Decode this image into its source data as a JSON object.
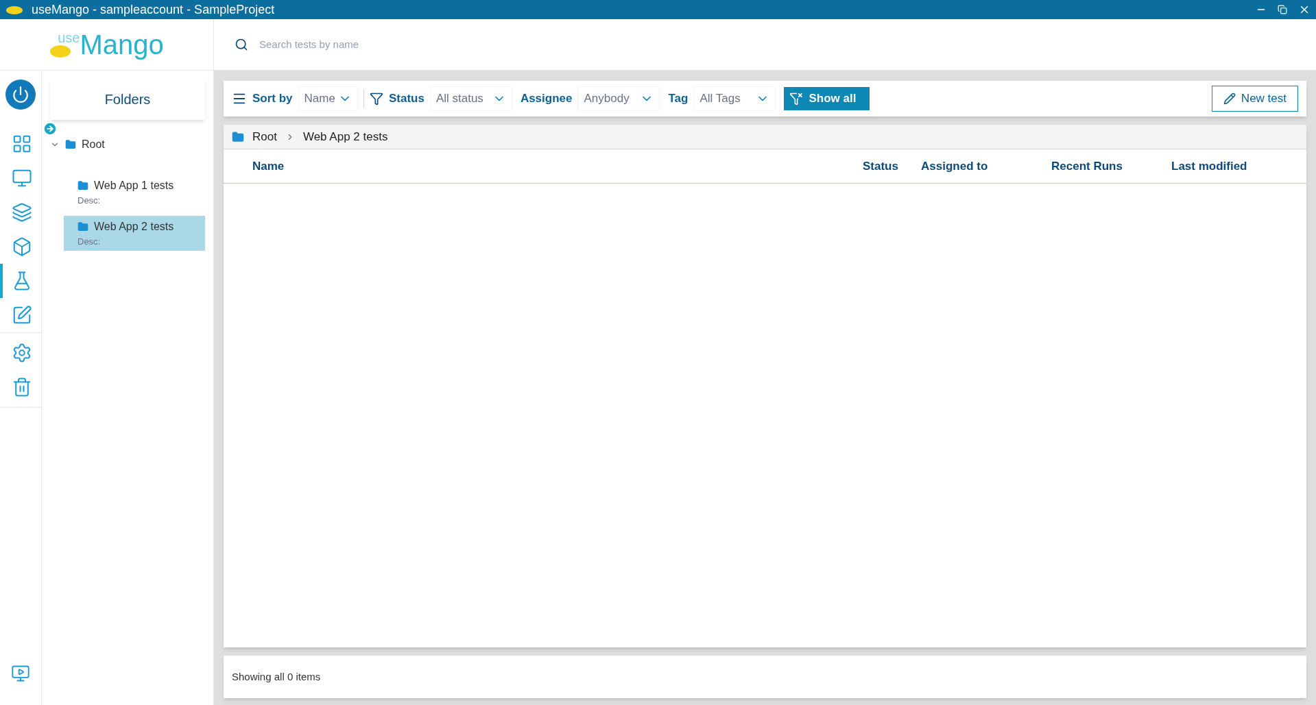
{
  "window": {
    "title": "useMango - sampleaccount - SampleProject"
  },
  "logo": {
    "prefix": "use",
    "name": "Mango"
  },
  "search": {
    "placeholder": "Search tests by name"
  },
  "nav": [
    {
      "kind": "dashboard",
      "selected": false
    },
    {
      "kind": "monitor",
      "selected": false
    },
    {
      "kind": "layers",
      "selected": false
    },
    {
      "kind": "cube",
      "selected": false
    },
    {
      "kind": "flask",
      "selected": true
    },
    {
      "kind": "edit",
      "selected": false
    },
    {
      "kind": "settings",
      "selected": false
    },
    {
      "kind": "trash",
      "selected": false
    }
  ],
  "folders": {
    "title": "Folders",
    "tree": [
      {
        "label": "Root",
        "expanded": true,
        "selected": false,
        "children": [
          {
            "label": "Web App 1 tests",
            "desc": "Desc:",
            "selected": false
          },
          {
            "label": "Web App 2 tests",
            "desc": "Desc:",
            "selected": true
          }
        ]
      }
    ]
  },
  "toolbar": {
    "sort_label": "Sort by",
    "sort_value": "Name",
    "filters": [
      {
        "label": "Status",
        "value": "All status"
      },
      {
        "label": "Assignee",
        "value": "Anybody"
      },
      {
        "label": "Tag",
        "value": "All Tags"
      }
    ],
    "show_all": "Show all",
    "new_test": "New test"
  },
  "breadcrumb": [
    "Root",
    "Web App 2 tests"
  ],
  "table": {
    "columns": [
      "Name",
      "Status",
      "Assigned to",
      "Recent Runs",
      "Last modified"
    ]
  },
  "status_bar": "Showing all 0 items"
}
